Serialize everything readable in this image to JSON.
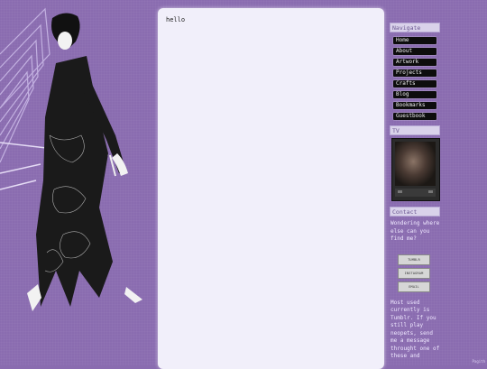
{
  "main": {
    "content": "hello"
  },
  "sidebar": {
    "navigate_title": "Navigate",
    "nav_items": [
      {
        "label": "Home"
      },
      {
        "label": "About"
      },
      {
        "label": "Artwork"
      },
      {
        "label": "Projects"
      },
      {
        "label": "Crafts"
      },
      {
        "label": "Blog"
      },
      {
        "label": "Bookmarks"
      },
      {
        "label": "Guestbook"
      }
    ],
    "tv_title": "TV",
    "contact_title": "Contact",
    "contact_text": "Wondering where else can you find me?",
    "contact_buttons": [
      {
        "label": "TUMBLR"
      },
      {
        "label": "INSTAGRAM"
      },
      {
        "label": "EMAIL"
      }
    ],
    "note_text": "Most used currently is Tumblr. If you still play neopets, send me a message throught one of these and"
  },
  "footer": {
    "corner_text": "Pagith"
  },
  "colors": {
    "background": "#8a6cb0",
    "panel": "#f1effa",
    "nav_button": "#0d0d0d",
    "section_title_bg": "#d9d2ea"
  }
}
